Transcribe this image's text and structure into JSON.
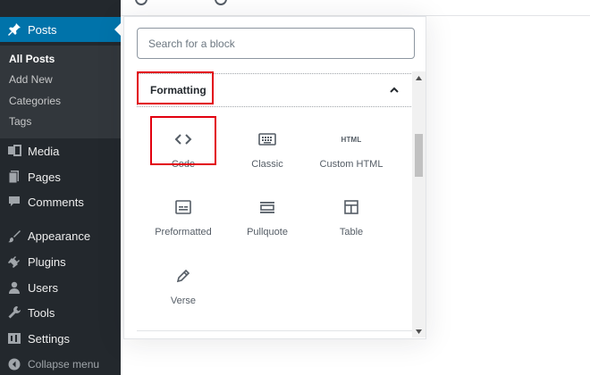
{
  "sidebar": {
    "posts_label": "Posts",
    "submenu": [
      "All Posts",
      "Add New",
      "Categories",
      "Tags"
    ],
    "items": [
      {
        "label": "Media",
        "icon": "media-icon"
      },
      {
        "label": "Pages",
        "icon": "pages-icon"
      },
      {
        "label": "Comments",
        "icon": "comments-icon"
      },
      {
        "label": "Appearance",
        "icon": "appearance-icon"
      },
      {
        "label": "Plugins",
        "icon": "plugins-icon"
      },
      {
        "label": "Users",
        "icon": "users-icon"
      },
      {
        "label": "Tools",
        "icon": "tools-icon"
      },
      {
        "label": "Settings",
        "icon": "settings-icon"
      }
    ],
    "collapse_label": "Collapse menu"
  },
  "inserter": {
    "search_placeholder": "Search for a block",
    "panel_title": "Formatting",
    "panel_expanded": true,
    "blocks": [
      {
        "label": "Code",
        "icon": "code-icon"
      },
      {
        "label": "Classic",
        "icon": "keyboard-icon"
      },
      {
        "label": "Custom HTML",
        "icon": "html-icon",
        "icon_text": "HTML"
      },
      {
        "label": "Preformatted",
        "icon": "preformatted-icon"
      },
      {
        "label": "Pullquote",
        "icon": "pullquote-icon"
      },
      {
        "label": "Table",
        "icon": "table-icon"
      },
      {
        "label": "Verse",
        "icon": "verse-icon"
      }
    ]
  },
  "colors": {
    "sidebar_bg": "#23282d",
    "submenu_bg": "#32373c",
    "active_bg": "#0073aa",
    "highlight": "#e2000f"
  }
}
